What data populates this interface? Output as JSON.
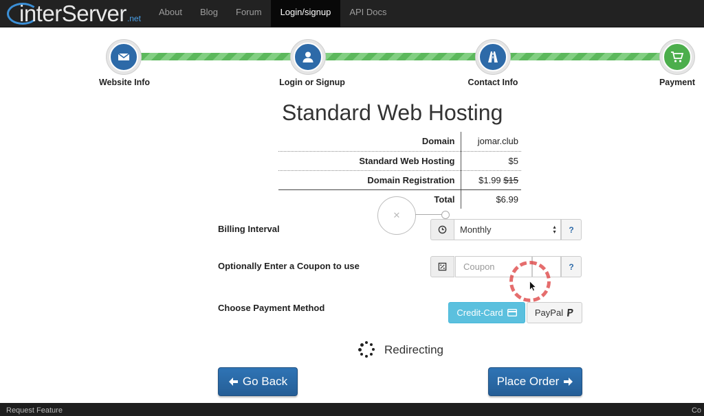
{
  "nav": {
    "logo_word": "interServer",
    "logo_tld": ".net",
    "items": [
      {
        "label": "About"
      },
      {
        "label": "Blog"
      },
      {
        "label": "Forum"
      },
      {
        "label": "Login/signup",
        "active": true
      },
      {
        "label": "API Docs"
      }
    ]
  },
  "steps": [
    {
      "label": "Website Info",
      "icon": "envelope-icon"
    },
    {
      "label": "Login or Signup",
      "icon": "user-icon"
    },
    {
      "label": "Contact Info",
      "icon": "road-icon"
    },
    {
      "label": "Payment",
      "icon": "cart-icon",
      "done": true
    }
  ],
  "title": "Standard Web Hosting",
  "summary": {
    "rows": [
      {
        "key": "Domain",
        "value": "jomar.club"
      },
      {
        "key": "Standard Web Hosting",
        "value": "$5"
      },
      {
        "key": "Domain Registration",
        "value": "$1.99",
        "old": "$15"
      },
      {
        "key": "Total",
        "value": "$6.99"
      }
    ]
  },
  "billing": {
    "label": "Billing Interval",
    "selected": "Monthly",
    "help": "?"
  },
  "coupon": {
    "label": "Optionally Enter a Coupon to use",
    "placeholder": "Coupon",
    "help": "?"
  },
  "payment": {
    "label": "Choose Payment Method",
    "credit_card": "Credit-Card",
    "paypal": "PayPal"
  },
  "status": {
    "text": "Redirecting"
  },
  "actions": {
    "back": "Go Back",
    "place_order": "Place Order"
  },
  "footer": {
    "left": "Request Feature",
    "right": "Co"
  },
  "colors": {
    "primary": "#2d6aa8",
    "success": "#5cb85c",
    "info": "#5bc0de",
    "nav_bg": "#222222"
  }
}
